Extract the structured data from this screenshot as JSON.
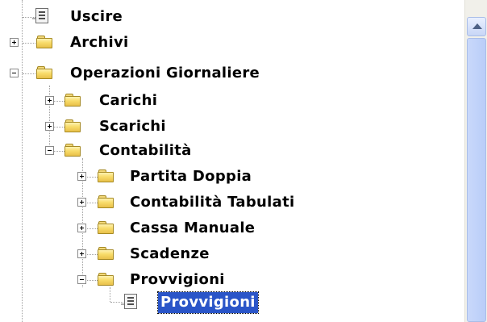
{
  "tree": {
    "items": [
      {
        "label": "Uscire",
        "icon": "document-icon",
        "expander": "none"
      },
      {
        "label": "Archivi",
        "icon": "folder-icon",
        "expander": "plus"
      },
      {
        "label": "Operazioni Giornaliere",
        "icon": "folder-icon",
        "expander": "minus"
      },
      {
        "label": "Carichi",
        "icon": "folder-icon",
        "expander": "plus"
      },
      {
        "label": "Scarichi",
        "icon": "folder-icon",
        "expander": "plus"
      },
      {
        "label": "Contabilità",
        "icon": "folder-icon",
        "expander": "minus"
      },
      {
        "label": "Partita Doppia",
        "icon": "folder-icon",
        "expander": "plus"
      },
      {
        "label": "Contabilità Tabulati",
        "icon": "folder-icon",
        "expander": "plus"
      },
      {
        "label": "Cassa Manuale",
        "icon": "folder-icon",
        "expander": "plus"
      },
      {
        "label": "Scadenze",
        "icon": "folder-icon",
        "expander": "plus"
      },
      {
        "label": "Provvigioni",
        "icon": "folder-icon",
        "expander": "minus"
      },
      {
        "label": "Provvigioni",
        "icon": "document-icon",
        "expander": "none",
        "selected": true
      }
    ]
  },
  "colors": {
    "selection": "#2a55c8",
    "folder": "#f8dc6a",
    "scrollbar_thumb": "#c9d8fb"
  }
}
